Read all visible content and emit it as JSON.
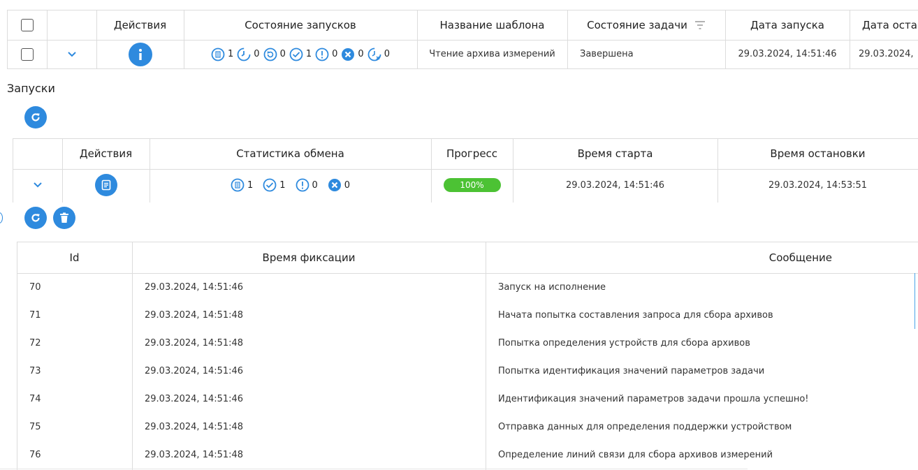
{
  "top_table": {
    "headers": {
      "actions": "Действия",
      "run_state": "Состояние запусков",
      "template_name": "Название шаблона",
      "task_state": "Состояние задачи",
      "start_date": "Дата запуска",
      "stop_date": "Дата оста"
    },
    "row": {
      "run_stats": [
        "1",
        "0",
        "0",
        "1",
        "0",
        "0",
        "0"
      ],
      "template_name": "Чтение архива измерений",
      "task_state": "Завершена",
      "start_date": "29.03.2024, 14:51:46",
      "stop_date": "29.03.2024,"
    }
  },
  "runs_section": {
    "title": "Запуски",
    "headers": {
      "actions": "Действия",
      "exchange_stats": "Статистика обмена",
      "progress": "Прогресс",
      "start_time": "Время старта",
      "stop_time": "Время остановки"
    },
    "row": {
      "stats": [
        "1",
        "1",
        "0",
        "0"
      ],
      "progress": "100%",
      "progress_value": 1.0,
      "start_time": "29.03.2024, 14:51:46",
      "stop_time": "29.03.2024, 14:53:51"
    }
  },
  "log_table": {
    "headers": {
      "id": "Id",
      "time": "Время фиксации",
      "message": "Сообщение"
    },
    "rows": [
      {
        "id": "70",
        "time": "29.03.2024, 14:51:46",
        "message": "Запуск на исполнение"
      },
      {
        "id": "71",
        "time": "29.03.2024, 14:51:48",
        "message": "Начата попытка составления запроса для сбора архивов"
      },
      {
        "id": "72",
        "time": "29.03.2024, 14:51:48",
        "message": "Попытка определения устройств для сбора архивов"
      },
      {
        "id": "73",
        "time": "29.03.2024, 14:51:46",
        "message": "Попытка идентификация значений параметров задачи"
      },
      {
        "id": "74",
        "time": "29.03.2024, 14:51:46",
        "message": "Идентификация значений параметров задачи прошла успешно!"
      },
      {
        "id": "75",
        "time": "29.03.2024, 14:51:48",
        "message": "Отправка данных для определения поддержки устройством"
      },
      {
        "id": "76",
        "time": "29.03.2024, 14:51:48",
        "message": "Определение линий связи для сбора архивов измерений"
      }
    ]
  },
  "colors": {
    "accent": "#2e8ade",
    "progress": "#4cc234",
    "border": "#dcdcdc"
  },
  "icons": {
    "info": "info-icon",
    "refresh": "refresh-icon",
    "delete": "trash-icon",
    "details": "document-icon",
    "expand": "chevron-down-icon",
    "filter": "filter-icon"
  }
}
